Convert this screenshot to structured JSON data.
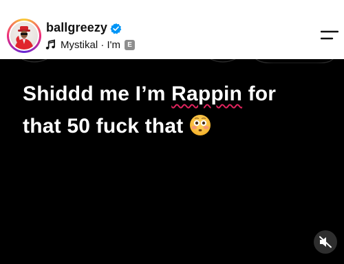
{
  "header": {
    "username": "ballgreezy",
    "verified": true,
    "audio": {
      "icon": "music-note-icon",
      "label": "Mystikal · I'm",
      "explicit_badge": "E"
    },
    "menu_icon": "menu-icon"
  },
  "post": {
    "caption_line1": "Shiddd me I’m",
    "caption_misspelled": "Rappin",
    "caption_line1_end": "for",
    "caption_line2": "that 50 fuck that",
    "emoji": "flushed-face-emoji"
  },
  "controls": {
    "mute_icon": "speaker-muted-icon"
  },
  "colors": {
    "header_bg": "#ffffff",
    "video_bg": "#000000",
    "verified_blue": "#0095f6",
    "spellcheck_red": "#e0245e"
  }
}
